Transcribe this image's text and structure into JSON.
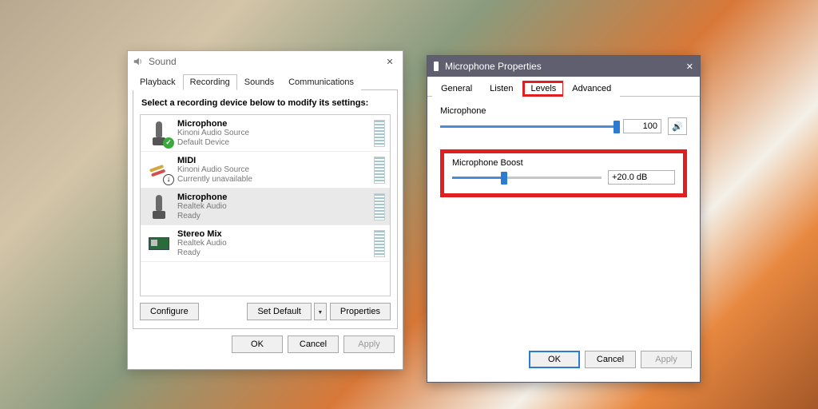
{
  "sound": {
    "title": "Sound",
    "tabs": [
      "Playback",
      "Recording",
      "Sounds",
      "Communications"
    ],
    "active_tab": 1,
    "instruction": "Select a recording device below to modify its settings:",
    "devices": [
      {
        "name": "Microphone",
        "line2": "Kinoni Audio Source",
        "line3": "Default Device",
        "icon": "mic",
        "badge": "check",
        "selected": false
      },
      {
        "name": "MIDI",
        "line2": "Kinoni Audio Source",
        "line3": "Currently unavailable",
        "icon": "cable",
        "badge": "down",
        "selected": false
      },
      {
        "name": "Microphone",
        "line2": "Realtek Audio",
        "line3": "Ready",
        "icon": "mic",
        "badge": "",
        "selected": true
      },
      {
        "name": "Stereo Mix",
        "line2": "Realtek Audio",
        "line3": "Ready",
        "icon": "mixer",
        "badge": "",
        "selected": false
      }
    ],
    "configure": "Configure",
    "set_default": "Set Default",
    "properties": "Properties",
    "ok": "OK",
    "cancel": "Cancel",
    "apply": "Apply"
  },
  "props": {
    "title": "Microphone Properties",
    "tabs": [
      "General",
      "Listen",
      "Levels",
      "Advanced"
    ],
    "active_tab": 2,
    "mic_label": "Microphone",
    "mic_value": "100",
    "mic_pct": 100,
    "boost_label": "Microphone Boost",
    "boost_value": "+20.0 dB",
    "boost_pct": 35,
    "ok": "OK",
    "cancel": "Cancel",
    "apply": "Apply"
  }
}
